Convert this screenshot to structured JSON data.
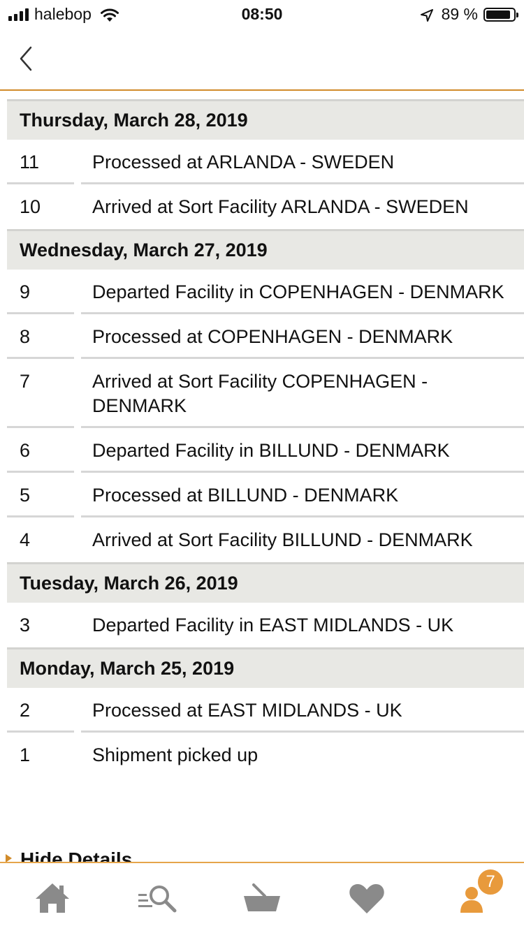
{
  "status_bar": {
    "carrier": "halebop",
    "time": "08:50",
    "battery_percent": "89 %",
    "battery_level": 0.89
  },
  "nav": {
    "back_icon": "chevron-left-icon"
  },
  "days": [
    {
      "date": "Thursday, March 28, 2019",
      "events": [
        {
          "num": "11",
          "desc": "Processed at ARLANDA - SWEDEN"
        },
        {
          "num": "10",
          "desc": "Arrived at Sort Facility ARLANDA - SWEDEN"
        }
      ]
    },
    {
      "date": "Wednesday, March 27, 2019",
      "events": [
        {
          "num": "9",
          "desc": "Departed Facility in COPENHAGEN - DENMARK"
        },
        {
          "num": "8",
          "desc": "Processed at COPENHAGEN - DENMARK"
        },
        {
          "num": "7",
          "desc": "Arrived at Sort Facility COPENHAGEN - DENMARK"
        },
        {
          "num": "6",
          "desc": "Departed Facility in BILLUND - DENMARK"
        },
        {
          "num": "5",
          "desc": "Processed at BILLUND - DENMARK"
        },
        {
          "num": "4",
          "desc": "Arrived at Sort Facility BILLUND - DENMARK"
        }
      ]
    },
    {
      "date": "Tuesday, March 26, 2019",
      "events": [
        {
          "num": "3",
          "desc": "Departed Facility in EAST MIDLANDS - UK"
        }
      ]
    },
    {
      "date": "Monday, March 25, 2019",
      "events": [
        {
          "num": "2",
          "desc": "Processed at EAST MIDLANDS - UK"
        },
        {
          "num": "1",
          "desc": "Shipment picked up"
        }
      ]
    }
  ],
  "hide_details_label": "Hide Details",
  "tabbar": {
    "items": [
      {
        "name": "home",
        "icon": "home-icon"
      },
      {
        "name": "search",
        "icon": "search-list-icon"
      },
      {
        "name": "basket",
        "icon": "basket-icon"
      },
      {
        "name": "favorites",
        "icon": "heart-icon"
      },
      {
        "name": "profile",
        "icon": "user-icon",
        "badge": "7"
      }
    ]
  },
  "colors": {
    "accent": "#d18b2a",
    "badge": "#e89a3c",
    "header_bg": "#e8e8e4",
    "icon_gray": "#8a8a8a"
  }
}
